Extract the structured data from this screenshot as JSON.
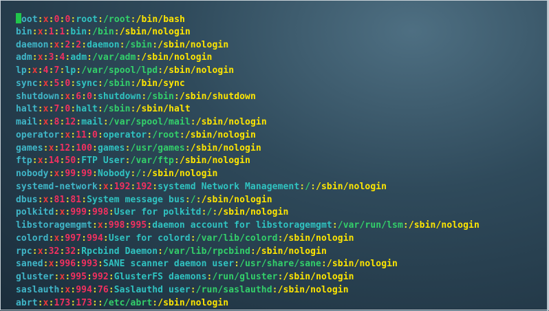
{
  "colors": {
    "field": "#40b6c8",
    "separator": "#e3dc2f",
    "x": "#ef3a3a",
    "id": "#f2305f",
    "desc": "#30c3c1",
    "home": "#33d06a",
    "shell": "#ffe600"
  },
  "terminal": {
    "lines": [
      [
        "oot",
        ":",
        "x",
        ":",
        "0",
        ":",
        "0",
        ":",
        "root",
        ":",
        "/root",
        ":",
        "/bin/bash"
      ],
      [
        "bin",
        ":",
        "x",
        ":",
        "1",
        ":",
        "1",
        ":",
        "bin",
        ":",
        "/bin",
        ":",
        "/sbin/nologin"
      ],
      [
        "daemon",
        ":",
        "x",
        ":",
        "2",
        ":",
        "2",
        ":",
        "daemon",
        ":",
        "/sbin",
        ":",
        "/sbin/nologin"
      ],
      [
        "adm",
        ":",
        "x",
        ":",
        "3",
        ":",
        "4",
        ":",
        "adm",
        ":",
        "/var/adm",
        ":",
        "/sbin/nologin"
      ],
      [
        "lp",
        ":",
        "x",
        ":",
        "4",
        ":",
        "7",
        ":",
        "lp",
        ":",
        "/var/spool/lpd",
        ":",
        "/sbin/nologin"
      ],
      [
        "sync",
        ":",
        "x",
        ":",
        "5",
        ":",
        "0",
        ":",
        "sync",
        ":",
        "/sbin",
        ":",
        "/bin/sync"
      ],
      [
        "shutdown",
        ":",
        "x",
        ":",
        "6",
        ":",
        "0",
        ":",
        "shutdown",
        ":",
        "/sbin",
        ":",
        "/sbin/shutdown"
      ],
      [
        "halt",
        ":",
        "x",
        ":",
        "7",
        ":",
        "0",
        ":",
        "halt",
        ":",
        "/sbin",
        ":",
        "/sbin/halt"
      ],
      [
        "mail",
        ":",
        "x",
        ":",
        "8",
        ":",
        "12",
        ":",
        "mail",
        ":",
        "/var/spool/mail",
        ":",
        "/sbin/nologin"
      ],
      [
        "operator",
        ":",
        "x",
        ":",
        "11",
        ":",
        "0",
        ":",
        "operator",
        ":",
        "/root",
        ":",
        "/sbin/nologin"
      ],
      [
        "games",
        ":",
        "x",
        ":",
        "12",
        ":",
        "100",
        ":",
        "games",
        ":",
        "/usr/games",
        ":",
        "/sbin/nologin"
      ],
      [
        "ftp",
        ":",
        "x",
        ":",
        "14",
        ":",
        "50",
        ":",
        "FTP User",
        ":",
        "/var/ftp",
        ":",
        "/sbin/nologin"
      ],
      [
        "nobody",
        ":",
        "x",
        ":",
        "99",
        ":",
        "99",
        ":",
        "Nobody",
        ":",
        "/",
        ":",
        "/sbin/nologin"
      ],
      [
        "systemd-network",
        ":",
        "x",
        ":",
        "192",
        ":",
        "192",
        ":",
        "systemd Network Management",
        ":",
        "/",
        ":",
        "/sbin/nologin"
      ],
      [
        "dbus",
        ":",
        "x",
        ":",
        "81",
        ":",
        "81",
        ":",
        "System message bus",
        ":",
        "/",
        ":",
        "/sbin/nologin"
      ],
      [
        "polkitd",
        ":",
        "x",
        ":",
        "999",
        ":",
        "998",
        ":",
        "User for polkitd",
        ":",
        "/",
        ":",
        "/sbin/nologin"
      ],
      [
        "libstoragemgmt",
        ":",
        "x",
        ":",
        "998",
        ":",
        "995",
        ":",
        "daemon account for libstoragemgmt",
        ":",
        "/var/run/lsm",
        ":",
        "/sbin/nologin"
      ],
      [
        "colord",
        ":",
        "x",
        ":",
        "997",
        ":",
        "994",
        ":",
        "User for colord",
        ":",
        "/var/lib/colord",
        ":",
        "/sbin/nologin"
      ],
      [
        "rpc",
        ":",
        "x",
        ":",
        "32",
        ":",
        "32",
        ":",
        "Rpcbind Daemon",
        ":",
        "/var/lib/rpcbind",
        ":",
        "/sbin/nologin"
      ],
      [
        "saned",
        ":",
        "x",
        ":",
        "996",
        ":",
        "993",
        ":",
        "SANE scanner daemon user",
        ":",
        "/usr/share/sane",
        ":",
        "/sbin/nologin"
      ],
      [
        "gluster",
        ":",
        "x",
        ":",
        "995",
        ":",
        "992",
        ":",
        "GlusterFS daemons",
        ":",
        "/run/gluster",
        ":",
        "/sbin/nologin"
      ],
      [
        "saslauth",
        ":",
        "x",
        ":",
        "994",
        ":",
        "76",
        ":",
        "Saslauthd user",
        ":",
        "/run/saslauthd",
        ":",
        "/sbin/nologin"
      ],
      [
        "abrt",
        ":",
        "x",
        ":",
        "173",
        ":",
        "173",
        ":",
        "",
        ":",
        "/etc/abrt",
        ":",
        "/sbin/nologin"
      ]
    ]
  }
}
